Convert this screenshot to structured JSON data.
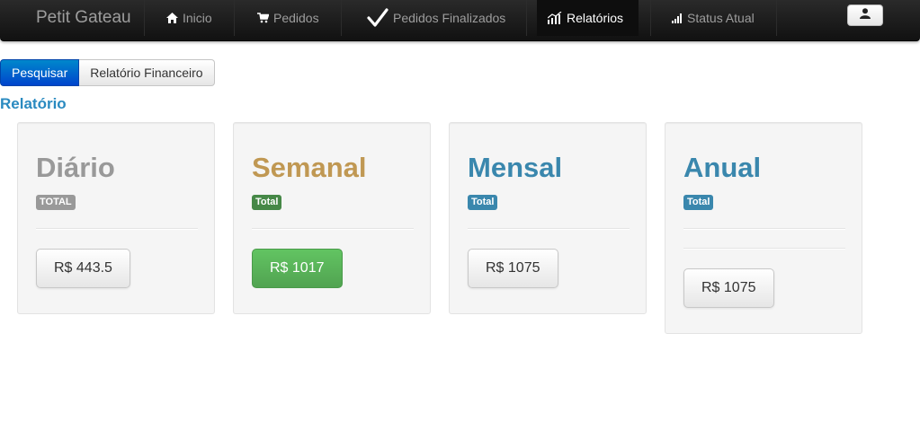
{
  "navbar": {
    "brand": "Petit Gateau",
    "items": [
      {
        "label": "Inicio",
        "icon": "home-icon"
      },
      {
        "label": "Pedidos",
        "icon": "cart-icon"
      },
      {
        "label": "Pedidos Finalizados",
        "icon": "checkmark-icon"
      },
      {
        "label": "Relatórios",
        "icon": "chart-icon",
        "active": true
      },
      {
        "label": "Status Atual",
        "icon": "signal-icon"
      }
    ],
    "user_icon": "user-icon"
  },
  "toolbar": {
    "search_label": "Pesquisar",
    "financial_report_label": "Relatório Financeiro"
  },
  "section": {
    "title": "Relatório"
  },
  "cards": [
    {
      "title": "Diário",
      "badge": "TOTAL",
      "value": "R$ 443.5",
      "title_color": "#999999",
      "badge_color": "#999999"
    },
    {
      "title": "Semanal",
      "badge": "Total",
      "value": "R$ 1017",
      "title_color": "#c09853",
      "badge_color": "#468847"
    },
    {
      "title": "Mensal",
      "badge": "Total",
      "value": "R$ 1075",
      "title_color": "#3a87ad",
      "badge_color": "#3a87ad"
    },
    {
      "title": "Anual",
      "badge": "Total",
      "value": "R$ 1075",
      "title_color": "#3a87ad",
      "badge_color": "#3a87ad"
    }
  ]
}
